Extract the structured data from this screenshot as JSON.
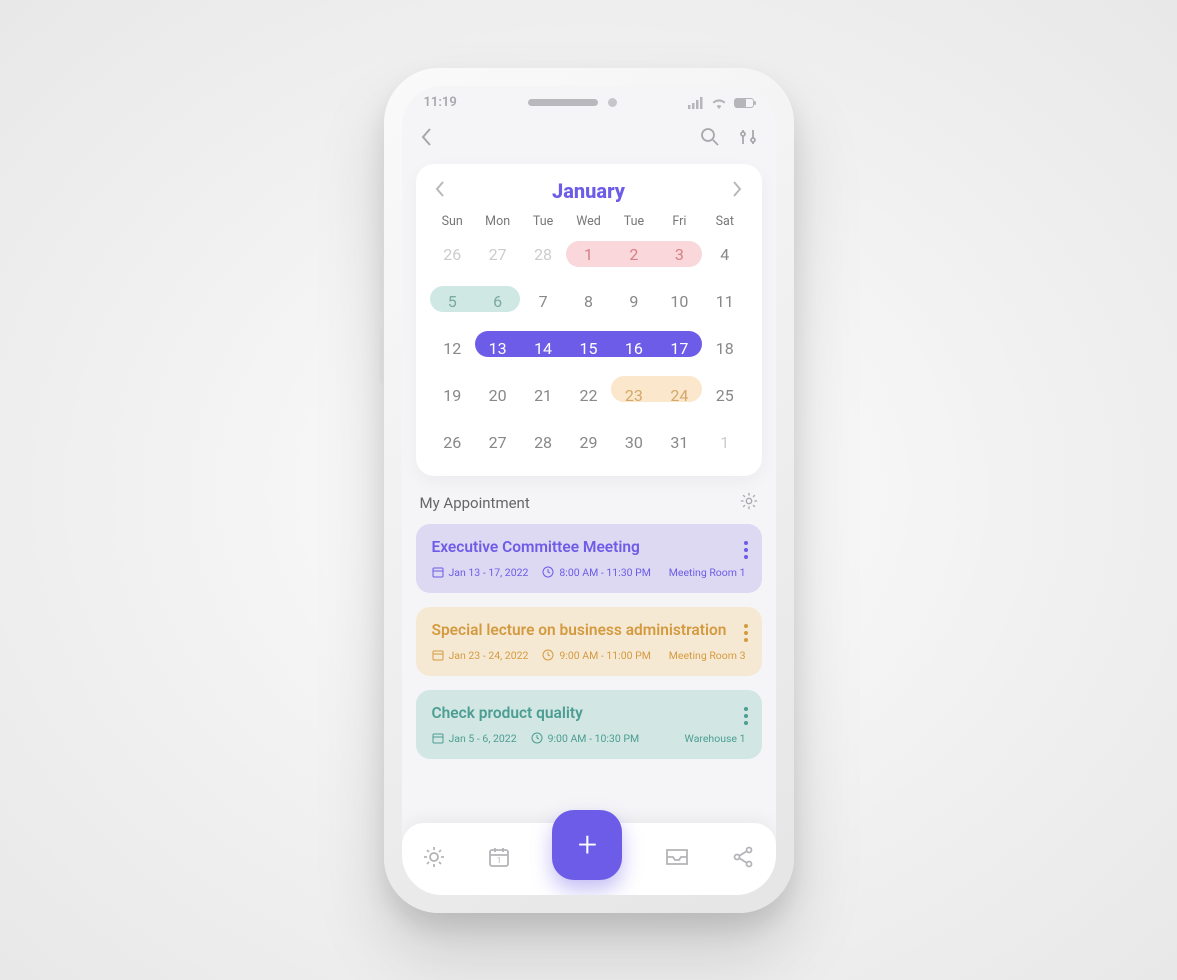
{
  "status": {
    "time": "11:19"
  },
  "calendar": {
    "month": "January",
    "dow": [
      "Sun",
      "Mon",
      "Tue",
      "Tue",
      "Wed",
      "Tue",
      "Fri",
      "Sat"
    ],
    "dow_fix": [
      "Sun",
      "Mon",
      "Tue",
      "Wed",
      "Tue",
      "Fri",
      "Sat"
    ],
    "weeks": [
      [
        "26",
        "27",
        "28",
        "1",
        "2",
        "3",
        "4"
      ],
      [
        "5",
        "6",
        "7",
        "8",
        "9",
        "10",
        "11"
      ],
      [
        "12",
        "13",
        "14",
        "15",
        "16",
        "17",
        "18"
      ],
      [
        "19",
        "20",
        "21",
        "22",
        "23",
        "24",
        "25"
      ],
      [
        "26",
        "27",
        "28",
        "29",
        "30",
        "31",
        "1"
      ]
    ]
  },
  "section_title": "My Appointment",
  "appointments": [
    {
      "title": "Executive Committee Meeting",
      "date": "Jan 13 - 17, 2022",
      "time": "8:00 AM - 11:30 PM",
      "loc": "Meeting Room 1",
      "color": "purple"
    },
    {
      "title": "Special lecture on business administration",
      "date": "Jan 23 - 24, 2022",
      "time": "9:00 AM - 11:00 PM",
      "loc": "Meeting Room 3",
      "color": "orange"
    },
    {
      "title": "Check product quality",
      "date": "Jan 5 - 6, 2022",
      "time": "9:00 AM - 10:30 PM",
      "loc": "Warehouse 1",
      "color": "teal"
    }
  ]
}
